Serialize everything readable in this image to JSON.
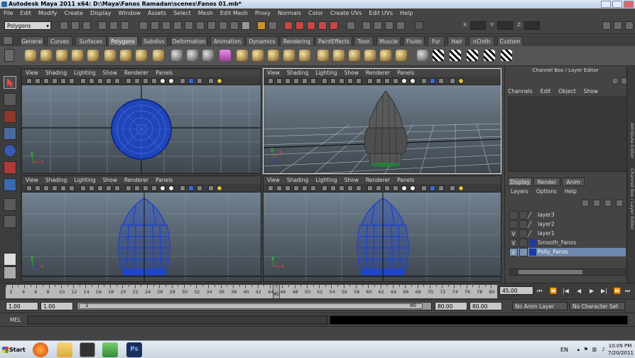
{
  "window": {
    "title": "Autodesk Maya 2011 x64: D:\\Maya\\Fanos Ramadan\\scenes\\Fanos 01.mb*"
  },
  "menubar": [
    "File",
    "Edit",
    "Modify",
    "Create",
    "Display",
    "Window",
    "Assets",
    "Select",
    "Mesh",
    "Edit Mesh",
    "Proxy",
    "Normals",
    "Color",
    "Create UVs",
    "Edit UVs",
    "Help"
  ],
  "statusline": {
    "menuset": "Polygons",
    "x_label": "X:",
    "y_label": "Y:",
    "z_label": "Z:"
  },
  "shelf_tabs": [
    "General",
    "Curves",
    "Surfaces",
    "Polygons",
    "Subdivs",
    "Deformation",
    "Animation",
    "Dynamics",
    "Rendering",
    "PaintEffects",
    "Toon",
    "Muscle",
    "Fluids",
    "Fur",
    "Hair",
    "nCloth",
    "Custom"
  ],
  "active_shelf_tab": "Polygons",
  "viewport_menu": [
    "View",
    "Shading",
    "Lighting",
    "Show",
    "Renderer",
    "Panels"
  ],
  "viewports": [
    {
      "name": "front-view"
    },
    {
      "name": "perspective-view"
    },
    {
      "name": "side-view-left"
    },
    {
      "name": "side-view-right"
    }
  ],
  "channel_box": {
    "title": "Channel Box / Layer Editor",
    "menu": [
      "Channels",
      "Edit",
      "Object",
      "Show"
    ]
  },
  "layer_editor": {
    "tabs": [
      "Display",
      "Render",
      "Anim"
    ],
    "menu": [
      "Layers",
      "Options",
      "Help"
    ],
    "layers": [
      {
        "name": "layer3",
        "visible": "",
        "selected": false
      },
      {
        "name": "layer2",
        "visible": "",
        "selected": false
      },
      {
        "name": "layer1",
        "visible": "V",
        "selected": false
      },
      {
        "name": "Smooth_Fanos",
        "visible": "V",
        "selected": false
      },
      {
        "name": "Polly_Fanos",
        "visible": "V",
        "selected": true
      }
    ]
  },
  "side_strip": {
    "attribute_editor": "Attribute Editor",
    "channel_box_tab": "Channel Box / Layer Editor"
  },
  "timeslider": {
    "ticks": [
      "2",
      "4",
      "6",
      "8",
      "10",
      "12",
      "14",
      "16",
      "18",
      "20",
      "22",
      "24",
      "26",
      "28",
      "30",
      "32",
      "34",
      "36",
      "38",
      "40",
      "42",
      "44",
      "46",
      "48",
      "50",
      "52",
      "54",
      "56",
      "58",
      "60",
      "62",
      "64",
      "66",
      "68",
      "70",
      "72",
      "74",
      "76",
      "78",
      "80"
    ],
    "current_frame": "45",
    "current_frame_field": "45.00"
  },
  "rangeslider": {
    "start": "1.00",
    "playback_start": "1.00",
    "range_start_label": "1",
    "range_end_label": "80",
    "playback_end": "80.00",
    "end": "80.00",
    "anim_layer": "No Anim Layer",
    "character_set": "No Character Set"
  },
  "commandline": {
    "label": "MEL"
  },
  "taskbar": {
    "start_label": "Start",
    "language": "EN",
    "time": "10:09 PM",
    "date": "7/20/2011"
  }
}
